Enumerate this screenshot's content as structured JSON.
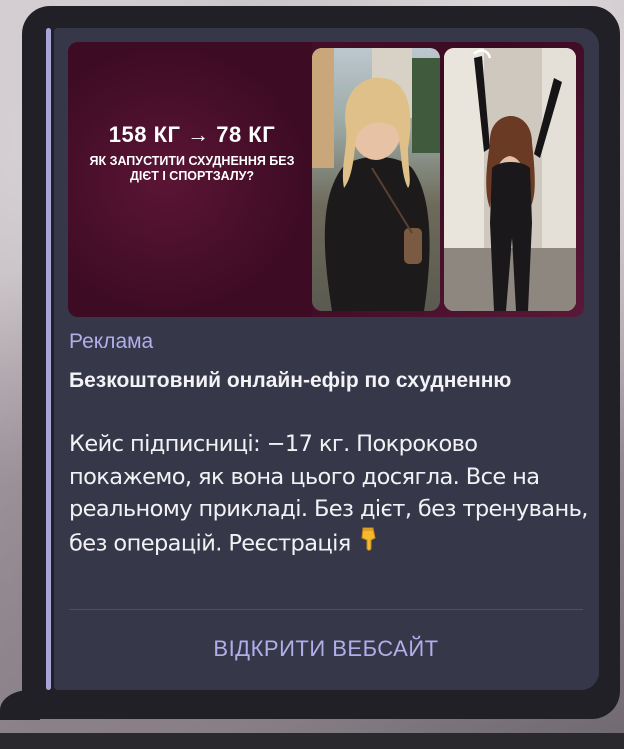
{
  "ad_image": {
    "headline": "158 КГ → 78 КГ",
    "subheadline": "ЯК ЗАПУСТИТИ СХУДНЕННЯ БЕЗ ДІЄТ І СПОРТЗАЛУ?"
  },
  "sponsored_label": "Реклама",
  "title": "Безкоштовний онлайн-ефір по схудненню",
  "body": "Кейс підписниці: −17 кг. Покроково покажемо, як вона цього досягла. Все на реальному прикладі. Без дієт, без тренувань, без операцій. Реєстрація",
  "cta_label": "ВІДКРИТИ ВЕБСАЙТ",
  "colors": {
    "accent": "#b2aeea",
    "card": "#37374a",
    "bubble": "#202026"
  },
  "icons": [
    "pointing-down-hand-icon"
  ]
}
